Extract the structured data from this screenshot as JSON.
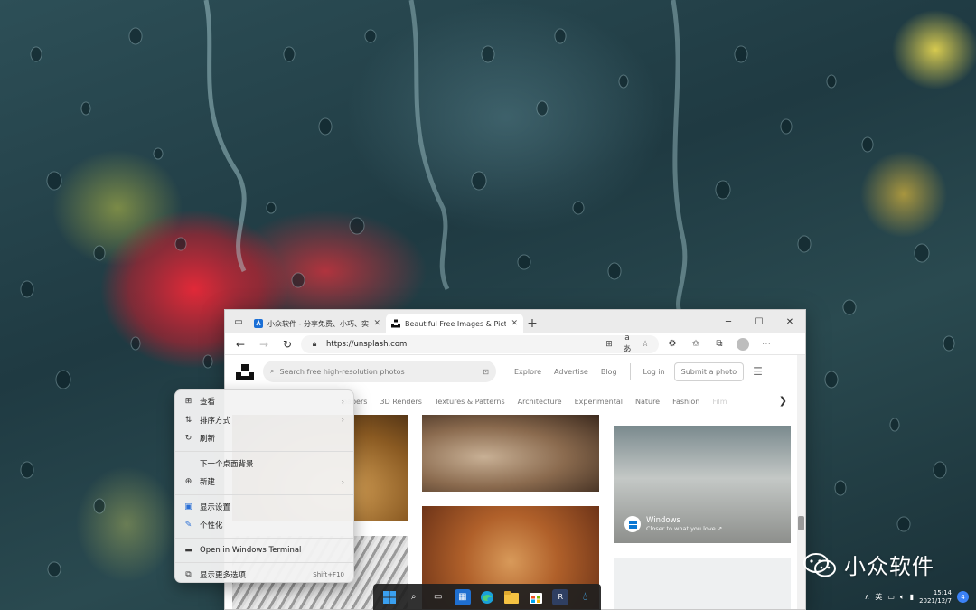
{
  "browser": {
    "tabs": [
      {
        "title": "小众软件 - 分享免费、小巧、实用、有趣、绿色的软件",
        "active": false
      },
      {
        "title": "Beautiful Free Images & Pictures | Unsplash",
        "active": true
      }
    ],
    "url": "https://unsplash.com"
  },
  "unsplash": {
    "search_placeholder": "Search free high-resolution photos",
    "nav": [
      "Explore",
      "Advertise",
      "Blog"
    ],
    "login": "Log in",
    "submit": "Submit a photo",
    "categories": [
      "papers",
      "3D Renders",
      "Textures & Patterns",
      "Architecture",
      "Experimental",
      "Nature",
      "Fashion",
      "Film"
    ],
    "promo": {
      "title": "Windows",
      "subtitle": "Closer to what you love ↗"
    }
  },
  "context_menu": {
    "items": [
      {
        "icon": "view-grid-icon",
        "label": "查看",
        "submenu": true
      },
      {
        "icon": "sort-icon",
        "label": "排序方式",
        "submenu": true
      },
      {
        "icon": "refresh-icon",
        "label": "刷新",
        "submenu": false
      },
      {
        "icon": "",
        "label": "下一个桌面背景",
        "submenu": false
      },
      {
        "icon": "new-icon",
        "label": "新建",
        "submenu": true
      },
      {
        "icon": "display-icon",
        "label": "显示设置",
        "submenu": false
      },
      {
        "icon": "personalize-icon",
        "label": "个性化",
        "submenu": false
      },
      {
        "icon": "terminal-icon",
        "label": "Open in Windows Terminal",
        "submenu": false
      },
      {
        "icon": "more-options-icon",
        "label": "显示更多选项",
        "shortcut": "Shift+F10"
      }
    ]
  },
  "tray": {
    "lang": "英",
    "time": "15:14",
    "date": "2021/12/7",
    "notifications": "4"
  },
  "watermark": {
    "text": "小众软件"
  },
  "colors": {
    "accent": "#0a78d4",
    "taskbar": "#202020"
  }
}
